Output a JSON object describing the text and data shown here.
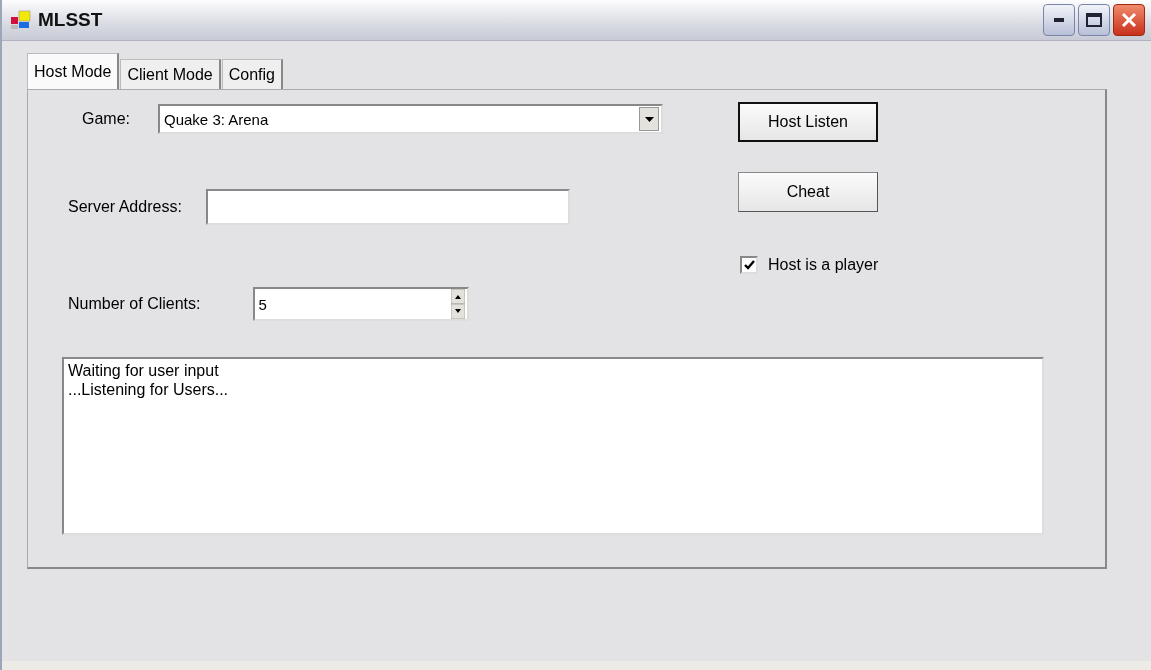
{
  "window": {
    "title": "MLSST"
  },
  "tabs": [
    {
      "label": "Host Mode",
      "selected": true
    },
    {
      "label": "Client Mode",
      "selected": false
    },
    {
      "label": "Config",
      "selected": false
    }
  ],
  "game": {
    "label": "Game:",
    "value": "Quake 3: Arena"
  },
  "server_address": {
    "label": "Server Address:"
  },
  "clients": {
    "label": "Number of Clients:",
    "value": "5"
  },
  "buttons": [
    {
      "label": "Host Listen",
      "default": true
    },
    {
      "label": "Cheat",
      "default": false
    }
  ],
  "host_is_player": {
    "label": "Host is a player",
    "checked": true
  },
  "log": [
    "Waiting for user input",
    "...Listening for Users..."
  ]
}
